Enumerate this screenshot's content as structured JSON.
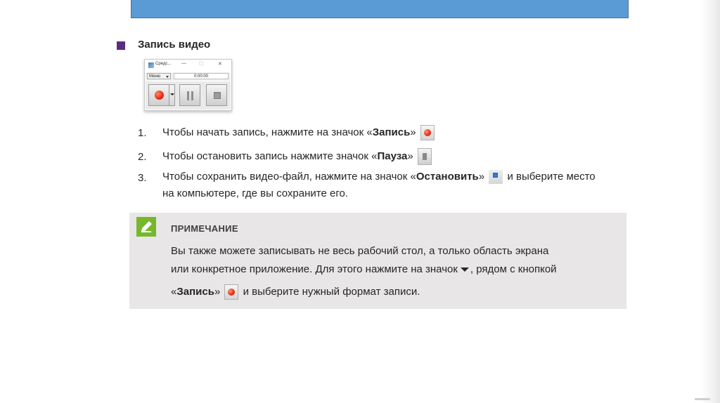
{
  "section": {
    "title": "Запись видео"
  },
  "recorder": {
    "title": "Средс...",
    "minimize": "—",
    "maximize": "☐",
    "close": "✕",
    "menu_label": "Меню",
    "time": "0:00:00"
  },
  "steps": [
    {
      "number": "1.",
      "before": "Чтобы начать запись, нажмите на значок «",
      "bold": "Запись",
      "after": "»"
    },
    {
      "number": "2.",
      "before": "Чтобы остановить запись нажмите значок «",
      "bold": "Пауза",
      "after": "»"
    },
    {
      "number": "3.",
      "before": "Чтобы сохранить видео-файл, нажмите на значок «",
      "bold": "Остановить",
      "after": "»",
      "after_icon": "и выберите место",
      "line2": "на компьютере, где вы сохраните его."
    }
  ],
  "note": {
    "heading": "ПРИМЕЧАНИЕ",
    "line1": "Вы также можете записывать не весь рабочий стол, а только область экрана",
    "line2_before": "или конкретное приложение. Для этого нажмите на значок",
    "line2_after": ", рядом с кнопкой",
    "line3_open": "«",
    "line3_bold": "Запись",
    "line3_close": "»",
    "line3_after": "и выберите нужный формат записи."
  },
  "colors": {
    "header_bar": "#5b9bd5",
    "section_marker": "#5b2c83",
    "note_background": "#e8e6e6",
    "note_icon": "#77b82a",
    "record_red": "#e8281c"
  },
  "icons": [
    "pencil-icon",
    "record-icon",
    "pause-icon",
    "stop-icon",
    "dropdown-arrow-icon"
  ]
}
